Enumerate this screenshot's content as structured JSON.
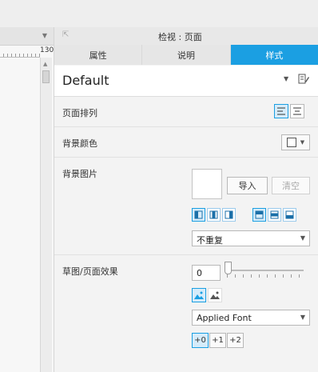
{
  "left_pane": {
    "ruler_value": "130"
  },
  "panel": {
    "title": "检视 : 页面",
    "tabs": [
      {
        "label": "属性",
        "active": false
      },
      {
        "label": "说明",
        "active": false
      },
      {
        "label": "样式",
        "active": true
      }
    ],
    "style_name": "Default",
    "rows": {
      "page_align": {
        "label": "页面排列"
      },
      "bg_color": {
        "label": "背景颜色"
      },
      "bg_image": {
        "label": "背景图片",
        "import_label": "导入",
        "clear_label": "清空",
        "repeat_value": "不重复"
      },
      "sketch": {
        "label": "草图/页面效果",
        "sketchiness_value": "0",
        "font_value": "Applied Font",
        "line_weights": [
          "+0",
          "+1",
          "+2"
        ]
      }
    }
  },
  "colors": {
    "accent": "#1b9fe2",
    "tab_active_text": "#ffffff"
  },
  "icons": [
    "pin-icon",
    "chevron-down-icon",
    "edit-style-icon",
    "align-left-icon",
    "align-center-icon",
    "color-swatch-icon",
    "image-align-icon",
    "color-image-icon",
    "grayscale-image-icon"
  ]
}
